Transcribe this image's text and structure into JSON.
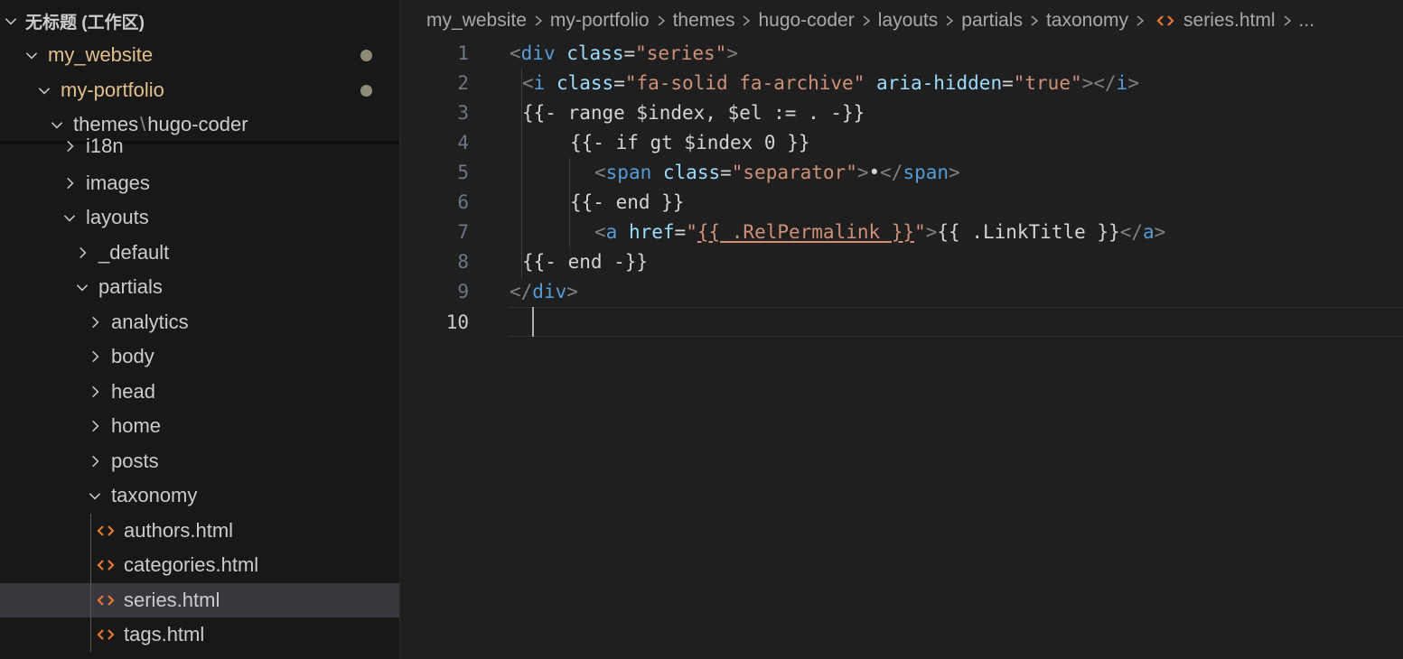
{
  "explorer": {
    "workspace_title": "无标题 (工作区)",
    "tree": [
      {
        "label": "my_website",
        "modified": true
      },
      {
        "label": "my-portfolio",
        "modified": true
      },
      {
        "label_a": "themes",
        "sep": "\\",
        "label_b": "hugo-coder"
      },
      {
        "label": "i18n"
      },
      {
        "label": "images"
      },
      {
        "label": "layouts"
      },
      {
        "label": "_default"
      },
      {
        "label": "partials"
      },
      {
        "label": "analytics"
      },
      {
        "label": "body"
      },
      {
        "label": "head"
      },
      {
        "label": "home"
      },
      {
        "label": "posts"
      },
      {
        "label": "taxonomy"
      },
      {
        "label": "authors.html"
      },
      {
        "label": "categories.html"
      },
      {
        "label": "series.html",
        "selected": true
      },
      {
        "label": "tags.html"
      }
    ]
  },
  "breadcrumb": {
    "items": [
      "my_website",
      "my-portfolio",
      "themes",
      "hugo-coder",
      "layouts",
      "partials",
      "taxonomy"
    ],
    "file": "series.html",
    "overflow": "..."
  },
  "editor": {
    "active_line": 10,
    "line_numbers": [
      "1",
      "2",
      "3",
      "4",
      "5",
      "6",
      "7",
      "8",
      "9",
      "10"
    ],
    "lines": [
      [
        "<",
        "div",
        " ",
        "class",
        "=",
        "\"series\"",
        ">"
      ],
      [
        "<",
        "i",
        " ",
        "class",
        "=",
        "\"fa-solid fa-archive\"",
        " ",
        "aria-hidden",
        "=",
        "\"true\"",
        "></",
        "i",
        ">"
      ],
      [
        "{{- range $index, $el := . -}}"
      ],
      [
        "{{- if gt $index 0 }}"
      ],
      [
        "<",
        "span",
        " ",
        "class",
        "=",
        "\"separator\"",
        ">",
        "•",
        "</",
        "span",
        ">"
      ],
      [
        "{{- end }}"
      ],
      [
        "<",
        "a",
        " ",
        "href",
        "=",
        "\"",
        "{{ .RelPermalink }}",
        "\"",
        ">",
        "{{ .LinkTitle }}",
        "</",
        "a",
        ">"
      ],
      [
        "{{- end -}}"
      ],
      [
        "</",
        "div",
        ">"
      ],
      [
        ""
      ]
    ]
  },
  "colors": {
    "sidebar_bg": "#181818",
    "editor_bg": "#1f1f1f",
    "selection_bg": "#37373d",
    "modified_text": "#e2c08d",
    "html_icon": "#e37933",
    "tag": "#569cd6",
    "attr": "#9cdcfe",
    "string": "#ce9178"
  }
}
